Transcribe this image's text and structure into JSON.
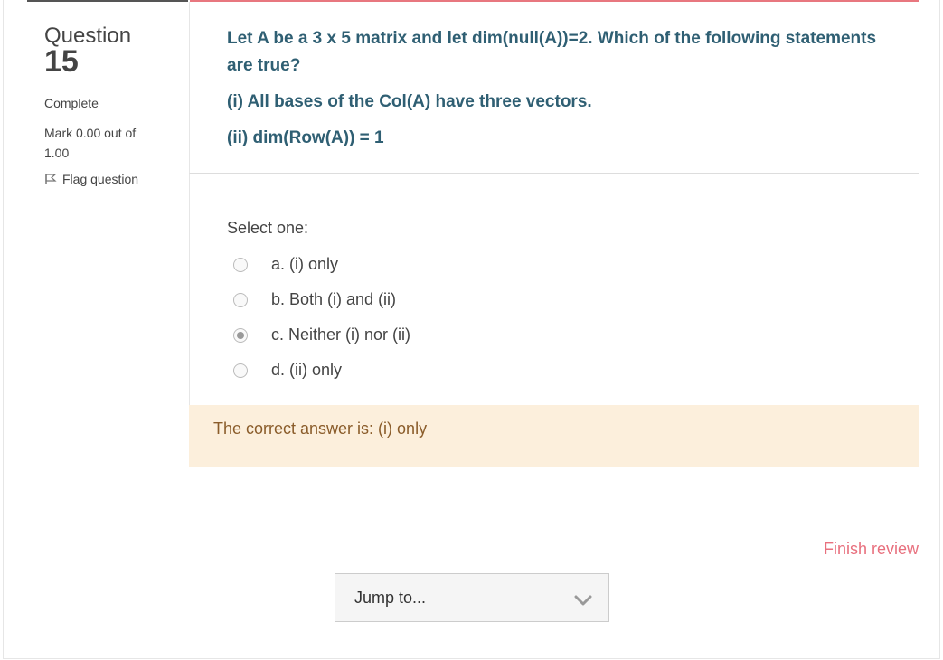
{
  "question_info": {
    "label": "Question",
    "number": "15",
    "state": "Complete",
    "grade": "Mark 0.00 out of 1.00",
    "flag_label": "Flag question"
  },
  "question": {
    "text_line": "Let A be a 3 x 5 matrix and let dim(null(A))=2. Which of the following statements are true?",
    "statement_1": "(i) All bases of the Col(A) have three vectors.",
    "statement_2": "(ii) dim(Row(A)) = 1"
  },
  "answer": {
    "prompt": "Select one:",
    "options": [
      {
        "label": "a. (i) only",
        "checked": false
      },
      {
        "label": "b. Both (i) and (ii)",
        "checked": false
      },
      {
        "label": "c. Neither (i) nor (ii)",
        "checked": true
      },
      {
        "label": "d. (ii) only",
        "checked": false
      }
    ]
  },
  "feedback": {
    "text": "The correct answer is: (i) only"
  },
  "navigation": {
    "finish_label": "Finish review",
    "jump_label": "Jump to..."
  },
  "colors": {
    "question_text": "#2f5f73",
    "accent_red": "#e8707e",
    "feedback_bg": "#fcefdc"
  }
}
